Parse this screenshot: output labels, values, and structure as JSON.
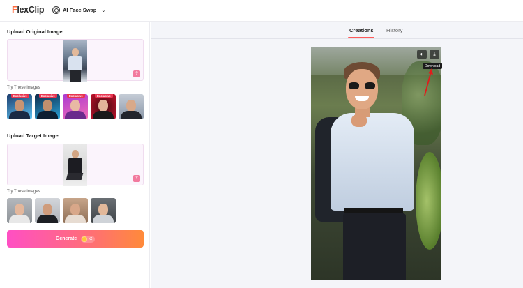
{
  "header": {
    "logo_f": "F",
    "logo_rest": "lexClip",
    "tool_label": "AI Face Swap"
  },
  "left": {
    "upload_original_title": "Upload Original Image",
    "upload_target_title": "Upload Target Image",
    "try_label_1": "Try These images",
    "try_label_2": "Try These images",
    "exclusive_badge": "Exclusive",
    "generate_label": "Generate",
    "credit_cost": "-2"
  },
  "right": {
    "tabs": [
      "Creations",
      "History"
    ],
    "active_tab": "Creations",
    "tooltip": "Download"
  },
  "colors": {
    "accent_gradient_start": "#ff4fc4",
    "accent_gradient_end": "#ff8a3a",
    "badge": "#e8344f",
    "tab_underline": "#ff5a5a"
  },
  "icons": {
    "tool_icon": "face-swap-icon",
    "compare_icon": "compare-icon",
    "download_icon": "download-icon",
    "upload_icon": "upload-icon",
    "coin_icon": "coin-icon"
  }
}
